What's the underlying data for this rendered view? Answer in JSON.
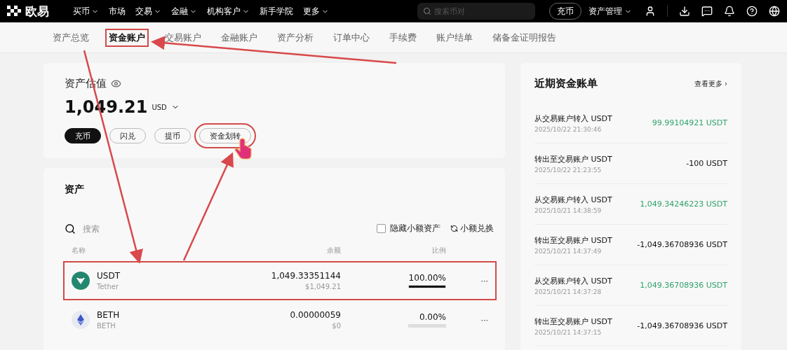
{
  "nav": {
    "logo": "欧易",
    "menu": [
      {
        "label": "买币",
        "dropdown": true
      },
      {
        "label": "市场",
        "dropdown": false
      },
      {
        "label": "交易",
        "dropdown": true
      },
      {
        "label": "金融",
        "dropdown": true
      },
      {
        "label": "机构客户",
        "dropdown": true
      },
      {
        "label": "新手学院",
        "dropdown": false
      },
      {
        "label": "更多",
        "dropdown": true
      }
    ],
    "search": {
      "placeholder": "搜索币对"
    },
    "deposit_button": "充币",
    "asset_menu": "资产管理"
  },
  "tabs": [
    {
      "label": "资产总览",
      "selected": false,
      "highlighted": false
    },
    {
      "label": "资金账户",
      "selected": true,
      "highlighted": true
    },
    {
      "label": "交易账户",
      "selected": false,
      "highlighted": false
    },
    {
      "label": "金融账户",
      "selected": false,
      "highlighted": false
    },
    {
      "label": "资产分析",
      "selected": false,
      "highlighted": false
    },
    {
      "label": "订单中心",
      "selected": false,
      "highlighted": false
    },
    {
      "label": "手续费",
      "selected": false,
      "highlighted": false
    },
    {
      "label": "账户结单",
      "selected": false,
      "highlighted": false
    },
    {
      "label": "储备金证明报告",
      "selected": false,
      "highlighted": false
    }
  ],
  "valuation": {
    "title": "资产估值",
    "amount": "1,049.21",
    "currency": "USD",
    "actions": [
      {
        "label": "充币",
        "primary": true,
        "highlighted": false
      },
      {
        "label": "闪兑",
        "primary": false,
        "highlighted": false
      },
      {
        "label": "提币",
        "primary": false,
        "highlighted": false
      },
      {
        "label": "资金划转",
        "primary": false,
        "highlighted": true
      }
    ]
  },
  "assets": {
    "title": "资产",
    "search": {
      "placeholder": "搜索"
    },
    "hide_small": {
      "label": "隐藏小额资产",
      "checked": false
    },
    "convert_small": "小额兑换",
    "columns": [
      "名称",
      "余额",
      "比例"
    ],
    "rows": [
      {
        "kind": "usdt",
        "symbol": "USDT",
        "name": "Tether",
        "balance": "1,049.33351144",
        "value": "$1,049.21",
        "ratio": "100.00%",
        "level": 1,
        "more": "···",
        "highlighted": true
      },
      {
        "kind": "eth",
        "symbol": "BETH",
        "name": "BETH",
        "balance": "0.00000059",
        "value": "$0",
        "ratio": "0.00%",
        "level": 0,
        "more": "···",
        "highlighted": false
      }
    ]
  },
  "recent_bills": {
    "title": "近期资金账单",
    "more": "查看更多 ›",
    "items": [
      {
        "title": "从交易账户转入 USDT",
        "time": "2025/10/22 21:30:46",
        "amount": "99.99104921 USDT",
        "kind": "in"
      },
      {
        "title": "转出至交易账户 USDT",
        "time": "2025/10/22 21:23:55",
        "amount": "-100 USDT",
        "kind": "out"
      },
      {
        "title": "从交易账户转入 USDT",
        "time": "2025/10/21 14:38:59",
        "amount": "1,049.34246223 USDT",
        "kind": "in"
      },
      {
        "title": "转出至交易账户 USDT",
        "time": "2025/10/21 14:37:49",
        "amount": "-1,049.36708936 USDT",
        "kind": "out"
      },
      {
        "title": "从交易账户转入 USDT",
        "time": "2025/10/21 14:37:28",
        "amount": "1,049.36708936 USDT",
        "kind": "in"
      },
      {
        "title": "转出至交易账户 USDT",
        "time": "2025/10/21 14:37:15",
        "amount": "-1,049.36708936 USDT",
        "kind": "out"
      }
    ]
  }
}
